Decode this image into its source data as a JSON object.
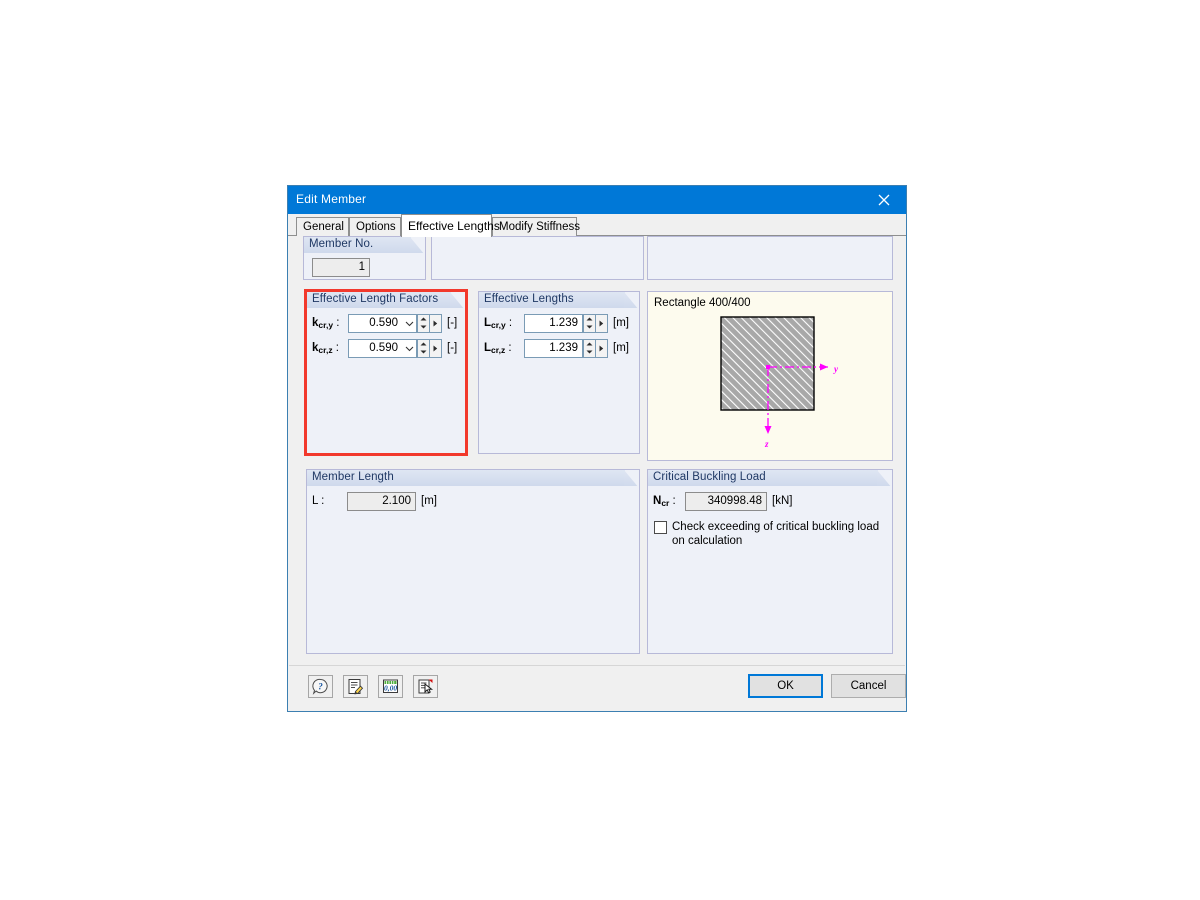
{
  "window": {
    "title": "Edit Member",
    "close_icon": "close-icon"
  },
  "tabs": [
    {
      "label": "General",
      "active": false
    },
    {
      "label": "Options",
      "active": false
    },
    {
      "label": "Effective Lengths",
      "active": true
    },
    {
      "label": "Modify Stiffness",
      "active": false
    }
  ],
  "member_no": {
    "group_label": "Member No.",
    "value": "1"
  },
  "effective_length_factors": {
    "group_label": "Effective Length Factors",
    "highlighted": true,
    "highlight_color": "#f2392c",
    "rows": [
      {
        "label_main": "k",
        "label_sub": "cr,y",
        "label_suffix": " :",
        "value": "0.590",
        "unit": "[-]",
        "has_dropdown": true
      },
      {
        "label_main": "k",
        "label_sub": "cr,z",
        "label_suffix": " :",
        "value": "0.590",
        "unit": "[-]",
        "has_dropdown": true
      }
    ]
  },
  "effective_lengths": {
    "group_label": "Effective Lengths",
    "rows": [
      {
        "label_main": "L",
        "label_sub": "cr,y",
        "label_suffix": " :",
        "value": "1.239",
        "unit": "[m]",
        "has_dropdown": false
      },
      {
        "label_main": "L",
        "label_sub": "cr,z",
        "label_suffix": " :",
        "value": "1.239",
        "unit": "[m]",
        "has_dropdown": false
      }
    ]
  },
  "cross_section": {
    "title": "Rectangle 400/400",
    "axis_y_label": "y",
    "axis_z_label": "z",
    "axis_color": "#ff00ff",
    "hatch_fill": "#a8a8a8",
    "background": "#fdfbee"
  },
  "member_length": {
    "group_label": "Member Length",
    "label": "L :",
    "value": "2.100",
    "unit": "[m]"
  },
  "critical_buckling_load": {
    "group_label": "Critical Buckling Load",
    "label_main": "N",
    "label_sub": "cr",
    "label_suffix": " :",
    "value": "340998.48",
    "unit": "[kN]",
    "checkbox_label": "Check exceeding of critical buckling load on calculation",
    "checkbox_checked": false
  },
  "footer": {
    "tools": [
      {
        "name": "help-icon",
        "title": "Help"
      },
      {
        "name": "edit-note-icon",
        "title": "Edit"
      },
      {
        "name": "numeric-display-icon",
        "title": "Numbers"
      },
      {
        "name": "pick-from-model-icon",
        "title": "Select"
      }
    ],
    "ok_label": "OK",
    "cancel_label": "Cancel"
  }
}
